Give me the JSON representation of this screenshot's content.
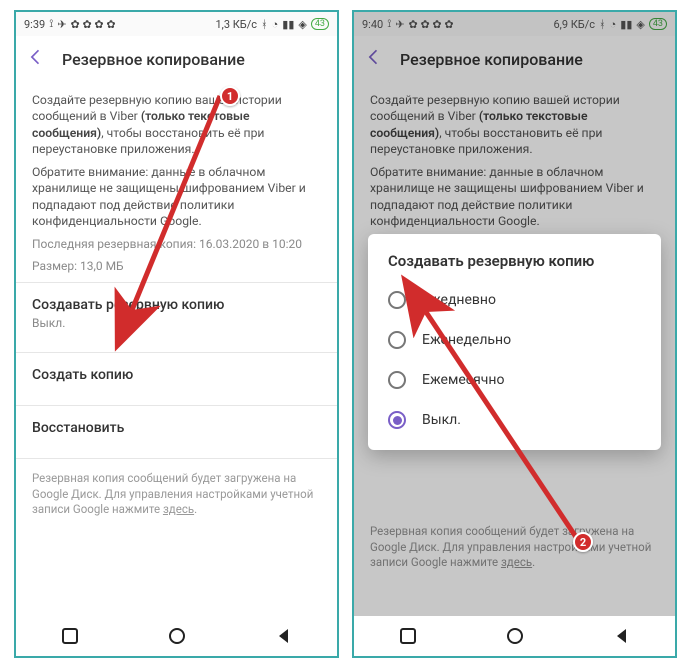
{
  "left": {
    "status": {
      "time": "9:39",
      "net": "1,3 КБ/с"
    },
    "appbar": {
      "title": "Резервное копирование"
    },
    "desc": {
      "p1a": "Создайте резервную копию вашей истории сообщений в Viber ",
      "p1b": "(только текстовые сообщения)",
      "p1c": ", чтобы восстановить её при переустановке приложения.",
      "p2": "Обратите внимание: данные в облачном хранилище не защищены шифрованием Viber и подпадают под действие политики конфиденциальности Google.",
      "last": "Последняя резервная копия: 16.03.2020 в 10:20",
      "size": "Размер: 13,0 МБ"
    },
    "items": {
      "auto": {
        "title": "Создавать резервную копию",
        "sub": "Выкл."
      },
      "create": {
        "title": "Создать копию"
      },
      "restore": {
        "title": "Восстановить"
      }
    },
    "foot": {
      "a": "Резервная копия сообщений будет загружена на Google Диск. Для управления настройками учетной записи Google нажмите ",
      "b": "здесь",
      "c": "."
    }
  },
  "right": {
    "status": {
      "time": "9:40",
      "net": "6,9 КБ/с"
    },
    "appbar": {
      "title": "Резервное копирование"
    },
    "desc": {
      "p1a": "Создайте резервную копию вашей истории сообщений в Viber ",
      "p1b": "(только текстовые сообщения)",
      "p1c": ", чтобы восстановить её при переустановке приложения.",
      "p2": "Обратите внимание: данные в облачном хранилище не защищены шифрованием Viber и подпадают под действие политики конфиденциальности Google."
    },
    "dialog": {
      "title": "Создавать резервную копию",
      "opt1": "Ежедневно",
      "opt2": "Еженедельно",
      "opt3": "Ежемесячно",
      "opt4": "Выкл."
    },
    "foot": {
      "a": "Резервная копия сообщений будет загружена на Google Диск. Для управления настройками учетной записи Google нажмите ",
      "b": "здесь",
      "c": "."
    }
  },
  "annot": {
    "badge1": "1",
    "badge2": "2"
  }
}
